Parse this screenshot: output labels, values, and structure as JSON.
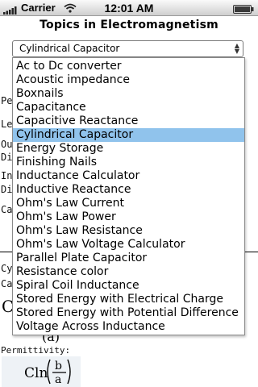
{
  "statusbar": {
    "carrier": "Carrier",
    "time": "12:01 AM"
  },
  "page": {
    "title": "Topics in Electromagnetism"
  },
  "selector": {
    "selected": "Cylindrical Capacitor",
    "options": [
      "Ac to Dc converter",
      "Acoustic impedance",
      "Boxnails",
      "Capacitance",
      "Capacitive Reactance",
      "Cylindrical Capacitor",
      "Energy Storage",
      "Finishing Nails",
      "Inductance Calculator",
      "Inductive Reactance",
      "Ohm's Law Current",
      "Ohm's Law Power",
      "Ohm's Law Resistance",
      "Ohm's Law Voltage Calculator",
      "Parallel Plate Capacitor",
      "Resistance color",
      "Spiral Coil Inductance",
      "Stored Energy with Electrical Charge",
      "Stored Energy with Potential Difference",
      "Voltage Across Inductance"
    ]
  },
  "background": {
    "fragments": [
      "Pe",
      "Le",
      "Ou",
      "Di",
      "Inn",
      "Di",
      "Ca",
      "Cy",
      "Ca",
      "C"
    ],
    "permittivity_label": "Permittivity:",
    "formula_partial": "(a)"
  }
}
